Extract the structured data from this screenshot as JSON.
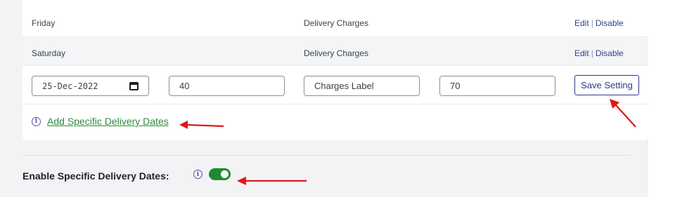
{
  "rows": [
    {
      "day": "Friday",
      "charge_type": "Delivery Charges",
      "edit": "Edit",
      "separator": "|",
      "disable": "Disable"
    },
    {
      "day": "Saturday",
      "charge_type": "Delivery Charges",
      "edit": "Edit",
      "separator": "|",
      "disable": "Disable"
    }
  ],
  "edit_row": {
    "date_value": "25-Dec-2022",
    "amount_value": "40",
    "label_value": "Charges Label",
    "charge_value": "70",
    "save_label": "Save Setting"
  },
  "add_link": "Add Specific Delivery Dates",
  "enable": {
    "label": "Enable Specific Delivery Dates:",
    "toggle_on": true
  },
  "colors": {
    "accent_blue": "#2f3a8f",
    "link_green": "#2f8a3a",
    "toggle_green": "#1f8a2e",
    "annotation_red": "#e01818"
  },
  "info_icon_glyph": "i"
}
